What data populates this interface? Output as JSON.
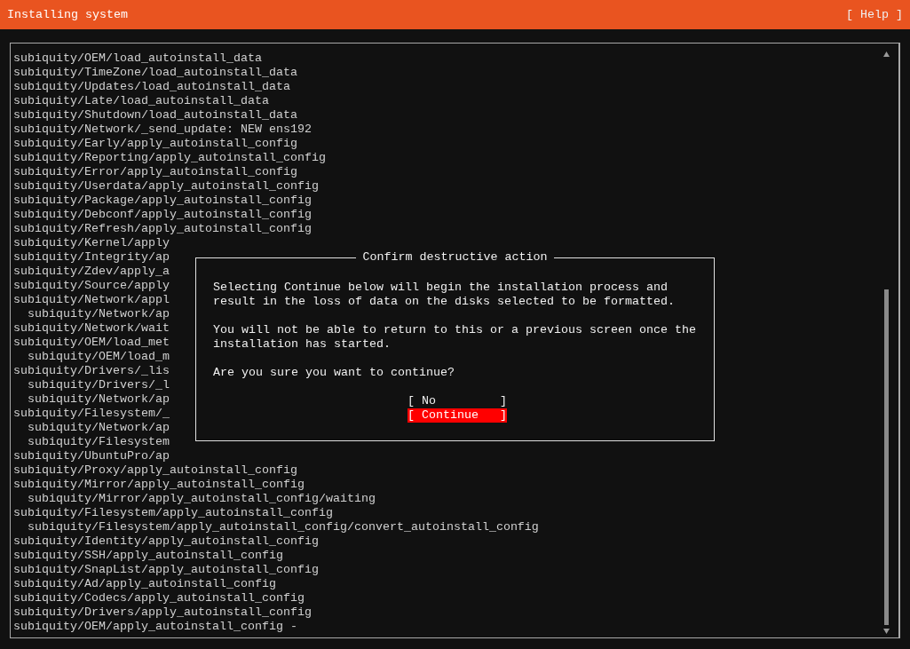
{
  "header": {
    "title": "Installing system",
    "help": "[ Help ]"
  },
  "log": [
    {
      "text": "subiquity/OEM/load_autoinstall_data"
    },
    {
      "text": "subiquity/TimeZone/load_autoinstall_data"
    },
    {
      "text": "subiquity/Updates/load_autoinstall_data"
    },
    {
      "text": "subiquity/Late/load_autoinstall_data"
    },
    {
      "text": "subiquity/Shutdown/load_autoinstall_data"
    },
    {
      "text": "subiquity/Network/_send_update: NEW ens192"
    },
    {
      "text": "subiquity/Early/apply_autoinstall_config"
    },
    {
      "text": "subiquity/Reporting/apply_autoinstall_config"
    },
    {
      "text": "subiquity/Error/apply_autoinstall_config"
    },
    {
      "text": "subiquity/Userdata/apply_autoinstall_config"
    },
    {
      "text": "subiquity/Package/apply_autoinstall_config"
    },
    {
      "text": "subiquity/Debconf/apply_autoinstall_config"
    },
    {
      "text": "subiquity/Refresh/apply_autoinstall_config"
    },
    {
      "text": "subiquity/Kernel/apply"
    },
    {
      "text": "subiquity/Integrity/ap"
    },
    {
      "text": "subiquity/Zdev/apply_a"
    },
    {
      "text": "subiquity/Source/apply"
    },
    {
      "text": "subiquity/Network/appl",
      "children": [
        {
          "text": "subiquity/Network/ap"
        }
      ]
    },
    {
      "text": "subiquity/Network/wait"
    },
    {
      "text": "subiquity/OEM/load_met",
      "children": [
        {
          "text": "subiquity/OEM/load_m"
        }
      ]
    },
    {
      "text": "subiquity/Drivers/_lis",
      "children": [
        {
          "text": "subiquity/Drivers/_l"
        },
        {
          "text": "subiquity/Network/ap"
        }
      ]
    },
    {
      "text": "subiquity/Filesystem/_",
      "children": [
        {
          "text": "subiquity/Network/ap"
        },
        {
          "text": "subiquity/Filesystem"
        }
      ]
    },
    {
      "text": "subiquity/UbuntuPro/ap"
    },
    {
      "text": "subiquity/Proxy/apply_autoinstall_config"
    },
    {
      "text": "subiquity/Mirror/apply_autoinstall_config",
      "children": [
        {
          "text": "subiquity/Mirror/apply_autoinstall_config/waiting"
        }
      ]
    },
    {
      "text": "subiquity/Filesystem/apply_autoinstall_config",
      "children": [
        {
          "text": "subiquity/Filesystem/apply_autoinstall_config/convert_autoinstall_config"
        }
      ]
    },
    {
      "text": "subiquity/Identity/apply_autoinstall_config"
    },
    {
      "text": "subiquity/SSH/apply_autoinstall_config"
    },
    {
      "text": "subiquity/SnapList/apply_autoinstall_config"
    },
    {
      "text": "subiquity/Ad/apply_autoinstall_config"
    },
    {
      "text": "subiquity/Codecs/apply_autoinstall_config"
    },
    {
      "text": "subiquity/Drivers/apply_autoinstall_config"
    },
    {
      "text": "subiquity/OEM/apply_autoinstall_config -"
    }
  ],
  "dialog": {
    "title": "Confirm destructive action",
    "paragraphs": [
      "Selecting Continue below will begin the installation process and result in the loss of data on the disks selected to be formatted.",
      "You will not be able to return to this or a previous screen once the installation has started.",
      "Are you sure you want to continue?"
    ],
    "buttons": [
      {
        "text": "[ No         ]",
        "selected": false
      },
      {
        "text": "[ Continue   ]",
        "selected": true
      }
    ]
  }
}
